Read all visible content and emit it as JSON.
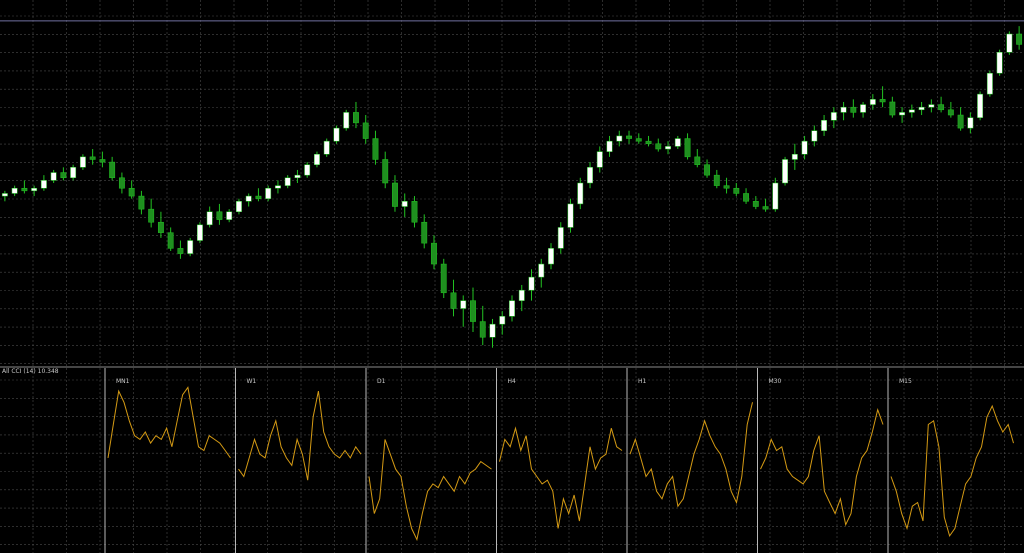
{
  "chart_data": [
    {
      "type": "candlestick",
      "colors": {
        "background": "#000000",
        "grid": "#4a4a4a",
        "bull": "#ffffff",
        "bear": "#1f8f1f",
        "wick": "#22c322",
        "level_line": "#6f6fa0"
      },
      "grid": true,
      "horizontal_level": 0.97,
      "ohlc": [
        [
          0.3,
          0.32,
          0.28,
          0.31
        ],
        [
          0.31,
          0.34,
          0.3,
          0.33
        ],
        [
          0.33,
          0.36,
          0.31,
          0.32
        ],
        [
          0.32,
          0.34,
          0.3,
          0.33
        ],
        [
          0.33,
          0.38,
          0.32,
          0.36
        ],
        [
          0.36,
          0.4,
          0.35,
          0.39
        ],
        [
          0.39,
          0.41,
          0.36,
          0.37
        ],
        [
          0.37,
          0.42,
          0.36,
          0.41
        ],
        [
          0.41,
          0.46,
          0.4,
          0.45
        ],
        [
          0.45,
          0.48,
          0.42,
          0.44
        ],
        [
          0.44,
          0.47,
          0.41,
          0.43
        ],
        [
          0.43,
          0.45,
          0.36,
          0.37
        ],
        [
          0.37,
          0.39,
          0.31,
          0.33
        ],
        [
          0.33,
          0.36,
          0.29,
          0.3
        ],
        [
          0.3,
          0.32,
          0.23,
          0.25
        ],
        [
          0.25,
          0.29,
          0.18,
          0.2
        ],
        [
          0.2,
          0.24,
          0.14,
          0.16
        ],
        [
          0.16,
          0.18,
          0.09,
          0.1
        ],
        [
          0.1,
          0.13,
          0.06,
          0.08
        ],
        [
          0.08,
          0.14,
          0.07,
          0.13
        ],
        [
          0.13,
          0.2,
          0.12,
          0.19
        ],
        [
          0.19,
          0.26,
          0.18,
          0.24
        ],
        [
          0.24,
          0.27,
          0.19,
          0.21
        ],
        [
          0.21,
          0.25,
          0.2,
          0.24
        ],
        [
          0.24,
          0.29,
          0.23,
          0.28
        ],
        [
          0.28,
          0.31,
          0.26,
          0.3
        ],
        [
          0.3,
          0.33,
          0.28,
          0.29
        ],
        [
          0.29,
          0.34,
          0.28,
          0.33
        ],
        [
          0.33,
          0.36,
          0.31,
          0.34
        ],
        [
          0.34,
          0.38,
          0.33,
          0.37
        ],
        [
          0.37,
          0.4,
          0.35,
          0.38
        ],
        [
          0.38,
          0.43,
          0.37,
          0.42
        ],
        [
          0.42,
          0.47,
          0.41,
          0.46
        ],
        [
          0.46,
          0.52,
          0.45,
          0.51
        ],
        [
          0.51,
          0.57,
          0.5,
          0.56
        ],
        [
          0.56,
          0.63,
          0.55,
          0.62
        ],
        [
          0.62,
          0.66,
          0.56,
          0.58
        ],
        [
          0.58,
          0.61,
          0.5,
          0.52
        ],
        [
          0.52,
          0.55,
          0.42,
          0.44
        ],
        [
          0.44,
          0.47,
          0.33,
          0.35
        ],
        [
          0.35,
          0.38,
          0.24,
          0.26
        ],
        [
          0.26,
          0.31,
          0.22,
          0.28
        ],
        [
          0.28,
          0.3,
          0.18,
          0.2
        ],
        [
          0.2,
          0.23,
          0.1,
          0.12
        ],
        [
          0.12,
          0.15,
          0.02,
          0.04
        ],
        [
          0.04,
          0.06,
          -0.09,
          -0.07
        ],
        [
          -0.07,
          -0.02,
          -0.16,
          -0.13
        ],
        [
          -0.13,
          -0.08,
          -0.2,
          -0.1
        ],
        [
          -0.1,
          -0.05,
          -0.22,
          -0.18
        ],
        [
          -0.18,
          -0.12,
          -0.27,
          -0.24
        ],
        [
          -0.24,
          -0.17,
          -0.28,
          -0.19
        ],
        [
          -0.19,
          -0.14,
          -0.23,
          -0.16
        ],
        [
          -0.16,
          -0.08,
          -0.18,
          -0.1
        ],
        [
          -0.1,
          -0.04,
          -0.14,
          -0.06
        ],
        [
          -0.06,
          0.02,
          -0.1,
          -0.01
        ],
        [
          -0.01,
          0.06,
          -0.05,
          0.04
        ],
        [
          0.04,
          0.12,
          0.02,
          0.1
        ],
        [
          0.1,
          0.2,
          0.08,
          0.18
        ],
        [
          0.18,
          0.29,
          0.16,
          0.27
        ],
        [
          0.27,
          0.37,
          0.25,
          0.35
        ],
        [
          0.35,
          0.43,
          0.33,
          0.41
        ],
        [
          0.41,
          0.49,
          0.39,
          0.47
        ],
        [
          0.47,
          0.53,
          0.45,
          0.51
        ],
        [
          0.51,
          0.55,
          0.49,
          0.53
        ],
        [
          0.53,
          0.55,
          0.5,
          0.52
        ],
        [
          0.52,
          0.54,
          0.5,
          0.51
        ],
        [
          0.51,
          0.53,
          0.49,
          0.5
        ],
        [
          0.5,
          0.52,
          0.47,
          0.48
        ],
        [
          0.48,
          0.51,
          0.46,
          0.49
        ],
        [
          0.49,
          0.53,
          0.48,
          0.52
        ],
        [
          0.52,
          0.54,
          0.44,
          0.45
        ],
        [
          0.45,
          0.48,
          0.41,
          0.42
        ],
        [
          0.42,
          0.44,
          0.37,
          0.38
        ],
        [
          0.38,
          0.4,
          0.33,
          0.34
        ],
        [
          0.34,
          0.37,
          0.31,
          0.33
        ],
        [
          0.33,
          0.35,
          0.3,
          0.31
        ],
        [
          0.31,
          0.33,
          0.27,
          0.28
        ],
        [
          0.28,
          0.3,
          0.25,
          0.26
        ],
        [
          0.26,
          0.29,
          0.24,
          0.25
        ],
        [
          0.25,
          0.37,
          0.24,
          0.35
        ],
        [
          0.35,
          0.45,
          0.34,
          0.44
        ],
        [
          0.44,
          0.5,
          0.4,
          0.46
        ],
        [
          0.46,
          0.53,
          0.44,
          0.51
        ],
        [
          0.51,
          0.57,
          0.49,
          0.55
        ],
        [
          0.55,
          0.61,
          0.53,
          0.59
        ],
        [
          0.59,
          0.64,
          0.56,
          0.62
        ],
        [
          0.62,
          0.66,
          0.59,
          0.64
        ],
        [
          0.64,
          0.67,
          0.6,
          0.62
        ],
        [
          0.62,
          0.66,
          0.6,
          0.65
        ],
        [
          0.65,
          0.69,
          0.63,
          0.67
        ],
        [
          0.67,
          0.72,
          0.64,
          0.66
        ],
        [
          0.66,
          0.68,
          0.6,
          0.61
        ],
        [
          0.61,
          0.64,
          0.58,
          0.62
        ],
        [
          0.62,
          0.65,
          0.6,
          0.63
        ],
        [
          0.63,
          0.66,
          0.61,
          0.64
        ],
        [
          0.64,
          0.67,
          0.62,
          0.65
        ],
        [
          0.65,
          0.68,
          0.62,
          0.63
        ],
        [
          0.63,
          0.66,
          0.6,
          0.61
        ],
        [
          0.61,
          0.64,
          0.55,
          0.56
        ],
        [
          0.56,
          0.62,
          0.54,
          0.6
        ],
        [
          0.6,
          0.7,
          0.59,
          0.69
        ],
        [
          0.69,
          0.78,
          0.68,
          0.77
        ],
        [
          0.77,
          0.86,
          0.76,
          0.85
        ],
        [
          0.85,
          0.93,
          0.84,
          0.92
        ],
        [
          0.92,
          0.95,
          0.86,
          0.88
        ]
      ]
    },
    {
      "type": "line",
      "indicator_label": "All CCI (14) 10.348",
      "color": "#d49a14",
      "segments": [
        {
          "label": "MN1",
          "values": [
            0.05,
            0.5,
            0.95,
            0.8,
            0.55,
            0.35,
            0.3,
            0.4,
            0.25,
            0.35,
            0.3,
            0.45,
            0.2,
            0.55,
            0.9,
            1.0,
            0.6,
            0.2,
            0.15,
            0.35,
            0.3,
            0.25,
            0.15,
            0.05
          ]
        },
        {
          "label": "W1",
          "values": [
            -0.1,
            -0.2,
            0.05,
            0.3,
            0.1,
            0.05,
            0.35,
            0.55,
            0.2,
            0.05,
            -0.05,
            0.3,
            0.1,
            -0.25,
            0.6,
            0.95,
            0.4,
            0.2,
            0.1,
            0.05,
            0.15,
            0.05,
            0.2,
            0.1
          ]
        },
        {
          "label": "D1",
          "values": [
            -0.2,
            -0.7,
            -0.5,
            0.3,
            0.1,
            -0.1,
            -0.2,
            -0.6,
            -0.9,
            -1.05,
            -0.7,
            -0.4,
            -0.3,
            -0.35,
            -0.2,
            -0.3,
            -0.4,
            -0.2,
            -0.3,
            -0.15,
            -0.1,
            0.0,
            -0.05,
            -0.1
          ]
        },
        {
          "label": "H4",
          "values": [
            0.0,
            0.3,
            0.2,
            0.45,
            0.15,
            0.35,
            -0.1,
            -0.2,
            -0.3,
            -0.25,
            -0.4,
            -0.9,
            -0.5,
            -0.7,
            -0.45,
            -0.8,
            -0.3,
            0.2,
            -0.1,
            0.05,
            0.1,
            0.45,
            0.2,
            0.15
          ]
        },
        {
          "label": "H1",
          "values": [
            0.1,
            0.3,
            0.05,
            -0.2,
            -0.1,
            -0.4,
            -0.5,
            -0.3,
            -0.2,
            -0.6,
            -0.5,
            -0.2,
            0.1,
            0.3,
            0.55,
            0.35,
            0.2,
            0.1,
            -0.1,
            -0.4,
            -0.55,
            -0.2,
            0.5,
            0.8
          ]
        },
        {
          "label": "M30",
          "values": [
            -0.1,
            0.05,
            0.3,
            0.15,
            0.2,
            -0.1,
            -0.2,
            -0.25,
            -0.3,
            -0.2,
            0.15,
            0.35,
            -0.4,
            -0.55,
            -0.7,
            -0.5,
            -0.85,
            -0.7,
            -0.2,
            0.05,
            0.15,
            0.4,
            0.7,
            0.5
          ]
        },
        {
          "label": "M15",
          "values": [
            -0.2,
            -0.4,
            -0.7,
            -0.9,
            -0.6,
            -0.55,
            -0.8,
            0.5,
            0.55,
            0.2,
            -0.75,
            -1.0,
            -0.9,
            -0.6,
            -0.3,
            -0.2,
            0.05,
            0.2,
            0.6,
            0.75,
            0.55,
            0.4,
            0.5,
            0.25
          ]
        }
      ]
    }
  ]
}
